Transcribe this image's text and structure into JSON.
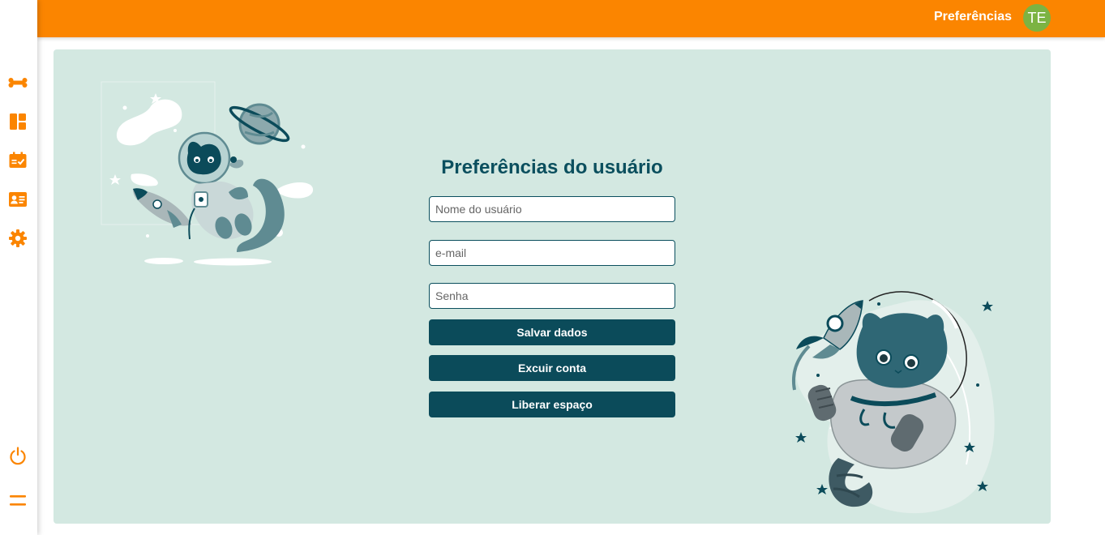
{
  "topbar": {
    "title": "Preferências",
    "avatar_initials": "TE"
  },
  "sidebar": {
    "items": [
      {
        "icon": "bone-icon"
      },
      {
        "icon": "dashboard-icon"
      },
      {
        "icon": "calendar-check-icon"
      },
      {
        "icon": "id-card-icon"
      },
      {
        "icon": "gear-icon"
      }
    ],
    "bottom": [
      {
        "icon": "power-icon"
      },
      {
        "icon": "menu-icon"
      }
    ]
  },
  "form": {
    "title": "Preferências do usuário",
    "username_placeholder": "Nome do usuário",
    "email_placeholder": "e-mail",
    "password_placeholder": "Senha",
    "save_label": "Salvar dados",
    "delete_label": "Excuir conta",
    "free_space_label": "Liberar espaço"
  },
  "colors": {
    "accent": "#fb8500",
    "panel_bg": "#d3e8e1",
    "primary_dark": "#0b4b5a",
    "avatar": "#7cb342"
  }
}
